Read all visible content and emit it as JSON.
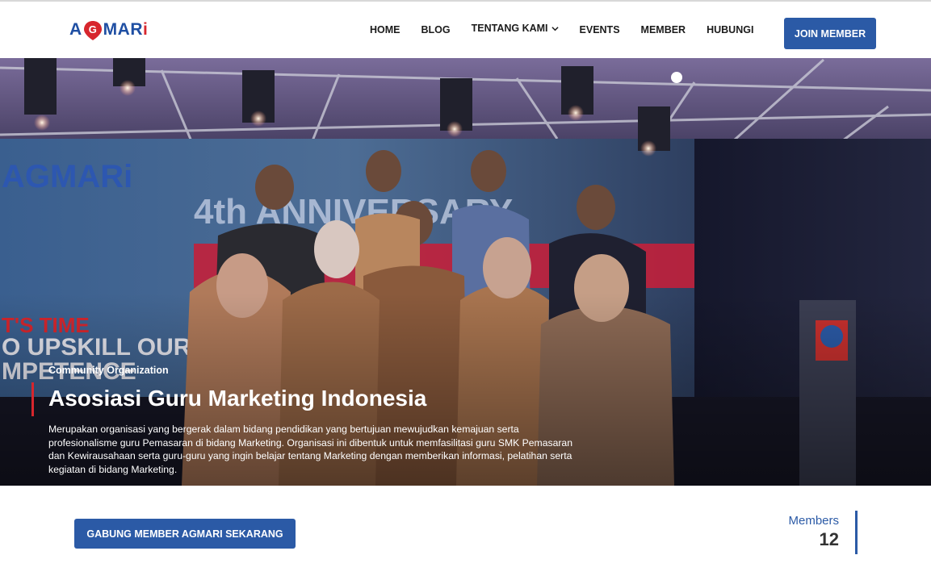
{
  "header": {
    "logo": {
      "part_a": "A",
      "part_g": "G",
      "part_mar": "MAR",
      "part_i": "i"
    },
    "nav": [
      {
        "label": "HOME"
      },
      {
        "label": "BLOG"
      },
      {
        "label": "TENTANG KAMI",
        "has_dropdown": true
      },
      {
        "label": "EVENTS"
      },
      {
        "label": "MEMBER"
      },
      {
        "label": "HUBUNGI"
      }
    ],
    "join_label": "JOIN MEMBER"
  },
  "hero": {
    "eyebrow": "Community Organization",
    "title": "Asosiasi Guru Marketing Indonesia",
    "description": "Merupakan organisasi yang bergerak dalam bidang pendidikan yang bertujuan mewujudkan kemajuan serta profesionalisme guru Pemasaran di bidang Marketing. Organisasi ini dibentuk untuk memfasilitasi guru SMK Pemasaran dan Kewirausahaan serta guru-guru yang ingin belajar tentang Marketing dengan memberikan informasi, pelatihan serta kegiatan di bidang Marketing."
  },
  "cta_label": "GABUNG MEMBER AGMARI SEKARANG",
  "members": {
    "label": "Members",
    "count": "12"
  },
  "colors": {
    "brand_blue": "#2b5aa6",
    "brand_red": "#d7262d"
  },
  "icons": {
    "dropdown": "chevron-down-icon",
    "logo_pin": "location-pin-icon"
  }
}
